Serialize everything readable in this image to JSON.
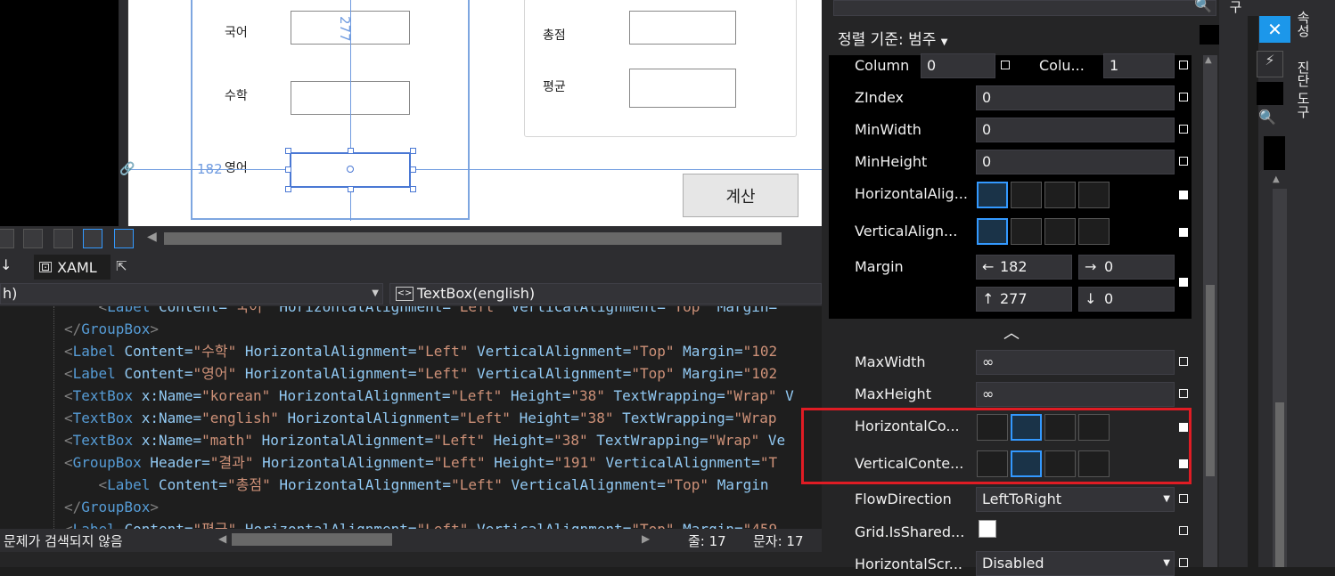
{
  "designer": {
    "labels": [
      "국어",
      "수학",
      "영어",
      "총점",
      "평균"
    ],
    "button_calc": "계산",
    "dim_vertical": "277",
    "dim_horizontal": "182"
  },
  "xaml_tab": "XAML",
  "dropdown_left": "h)",
  "dropdown_right": "TextBox(english)",
  "code_lines": [
    {
      "indent": "    ",
      "parts": [
        [
          "tag",
          "<"
        ],
        [
          "el",
          "Label"
        ],
        [
          "at",
          " Content="
        ],
        [
          "st",
          "\"국어\""
        ],
        [
          "at",
          " HorizontalAlignment="
        ],
        [
          "st",
          "\"Left\""
        ],
        [
          "at",
          " VerticalAlignment="
        ],
        [
          "st",
          "\"Top\""
        ],
        [
          "at",
          " Margin="
        ],
        [
          "st",
          "\""
        ]
      ]
    },
    {
      "indent": "",
      "parts": [
        [
          "tag",
          "</"
        ],
        [
          "el",
          "GroupBox"
        ],
        [
          "tag",
          ">"
        ]
      ]
    },
    {
      "indent": "",
      "parts": [
        [
          "tag",
          "<"
        ],
        [
          "el",
          "Label"
        ],
        [
          "at",
          " Content="
        ],
        [
          "st",
          "\"수학\""
        ],
        [
          "at",
          " HorizontalAlignment="
        ],
        [
          "st",
          "\"Left\""
        ],
        [
          "at",
          " VerticalAlignment="
        ],
        [
          "st",
          "\"Top\""
        ],
        [
          "at",
          " Margin="
        ],
        [
          "st",
          "\"102"
        ]
      ]
    },
    {
      "indent": "",
      "parts": [
        [
          "tag",
          "<"
        ],
        [
          "el",
          "Label"
        ],
        [
          "at",
          " Content="
        ],
        [
          "st",
          "\"영어\""
        ],
        [
          "at",
          " HorizontalAlignment="
        ],
        [
          "st",
          "\"Left\""
        ],
        [
          "at",
          " VerticalAlignment="
        ],
        [
          "st",
          "\"Top\""
        ],
        [
          "at",
          " Margin="
        ],
        [
          "st",
          "\"102"
        ]
      ]
    },
    {
      "indent": "",
      "parts": [
        [
          "tag",
          "<"
        ],
        [
          "el",
          "TextBox"
        ],
        [
          "at",
          " x:Name="
        ],
        [
          "st",
          "\"korean\""
        ],
        [
          "at",
          " HorizontalAlignment="
        ],
        [
          "st",
          "\"Left\""
        ],
        [
          "at",
          " Height="
        ],
        [
          "st",
          "\"38\""
        ],
        [
          "at",
          " TextWrapping="
        ],
        [
          "st",
          "\"Wrap\""
        ],
        [
          "at",
          " V"
        ]
      ]
    },
    {
      "indent": "",
      "parts": [
        [
          "tag",
          "<"
        ],
        [
          "el",
          "TextBox"
        ],
        [
          "at",
          " x:Name="
        ],
        [
          "st",
          "\"english\""
        ],
        [
          "at",
          " HorizontalAlignment="
        ],
        [
          "st",
          "\"Left\""
        ],
        [
          "at",
          " Height="
        ],
        [
          "st",
          "\"38\""
        ],
        [
          "at",
          " TextWrapping="
        ],
        [
          "st",
          "\"Wrap"
        ]
      ]
    },
    {
      "indent": "",
      "parts": [
        [
          "tag",
          "<"
        ],
        [
          "el",
          "TextBox"
        ],
        [
          "at",
          " x:Name="
        ],
        [
          "st",
          "\"math\""
        ],
        [
          "at",
          " HorizontalAlignment="
        ],
        [
          "st",
          "\"Left\""
        ],
        [
          "at",
          " Height="
        ],
        [
          "st",
          "\"38\""
        ],
        [
          "at",
          " TextWrapping="
        ],
        [
          "st",
          "\"Wrap\""
        ],
        [
          "at",
          " Ve"
        ]
      ]
    },
    {
      "indent": "",
      "parts": [
        [
          "tag",
          "<"
        ],
        [
          "el",
          "GroupBox"
        ],
        [
          "at",
          " Header="
        ],
        [
          "st",
          "\"결과\""
        ],
        [
          "at",
          " HorizontalAlignment="
        ],
        [
          "st",
          "\"Left\""
        ],
        [
          "at",
          " Height="
        ],
        [
          "st",
          "\"191\""
        ],
        [
          "at",
          " VerticalAlignment="
        ],
        [
          "st",
          "\"T"
        ]
      ]
    },
    {
      "indent": "    ",
      "parts": [
        [
          "tag",
          "<"
        ],
        [
          "el",
          "Label"
        ],
        [
          "at",
          " Content="
        ],
        [
          "st",
          "\"총점\""
        ],
        [
          "at",
          " HorizontalAlignment="
        ],
        [
          "st",
          "\"Left\""
        ],
        [
          "at",
          " VerticalAlignment="
        ],
        [
          "st",
          "\"Top\""
        ],
        [
          "at",
          " Margin"
        ]
      ]
    },
    {
      "indent": "",
      "parts": [
        [
          "tag",
          "</"
        ],
        [
          "el",
          "GroupBox"
        ],
        [
          "tag",
          ">"
        ]
      ]
    },
    {
      "indent": "",
      "parts": [
        [
          "tag",
          "<"
        ],
        [
          "el",
          "Label"
        ],
        [
          "at",
          " Content="
        ],
        [
          "st",
          "\"평균\""
        ],
        [
          "at",
          " HorizontalAlignment="
        ],
        [
          "st",
          "\"Left\""
        ],
        [
          "at",
          " VerticalAlignment="
        ],
        [
          "st",
          "\"Top\""
        ],
        [
          "at",
          " Margin="
        ],
        [
          "st",
          "\"459"
        ]
      ]
    }
  ],
  "status": {
    "issues": "문제가 검색되지 않음",
    "line": "줄: 17",
    "char": "문자: 17"
  },
  "properties": {
    "sort_label": "정렬 기준: 범주",
    "column_label": "Column",
    "column_value": "0",
    "colspan_label": "Colu...",
    "colspan_value": "1",
    "zindex_label": "ZIndex",
    "zindex_value": "0",
    "minwidth_label": "MinWidth",
    "minwidth_value": "0",
    "minheight_label": "MinHeight",
    "minheight_value": "0",
    "halign_label": "HorizontalAlig...",
    "valign_label": "VerticalAlign...",
    "margin_label": "Margin",
    "margin_left": "182",
    "margin_right": "0",
    "margin_top": "277",
    "margin_bottom": "0",
    "maxwidth_label": "MaxWidth",
    "maxwidth_value": "∞",
    "maxheight_label": "MaxHeight",
    "maxheight_value": "∞",
    "hcontent_label": "HorizontalCo...",
    "vcontent_label": "VerticalConte...",
    "flow_label": "FlowDirection",
    "flow_value": "LeftToRight",
    "shared_label": "Grid.IsShared...",
    "hscroll_label": "HorizontalScr...",
    "hscroll_value": "Disabled"
  },
  "right_panel": {
    "tab1": "속성",
    "tab2": "진단 도구",
    "tab_top": "구"
  }
}
